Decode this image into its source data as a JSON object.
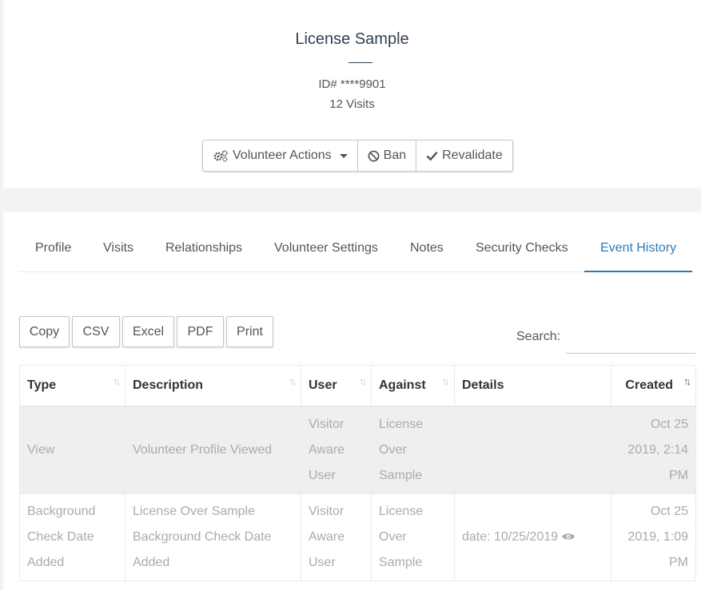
{
  "profile": {
    "name": "License Sample",
    "id_line": "ID# ****9901",
    "visits_line": "12 Visits"
  },
  "actions": {
    "volunteer_actions": "Volunteer Actions",
    "ban": "Ban",
    "revalidate": "Revalidate"
  },
  "tabs": [
    "Profile",
    "Visits",
    "Relationships",
    "Volunteer Settings",
    "Notes",
    "Security Checks",
    "Event History"
  ],
  "active_tab": "Event History",
  "export_buttons": [
    "Copy",
    "CSV",
    "Excel",
    "PDF",
    "Print"
  ],
  "search": {
    "label": "Search:",
    "value": ""
  },
  "table": {
    "columns": [
      "Type",
      "Description",
      "User",
      "Against",
      "Details",
      "Created"
    ],
    "rows": [
      {
        "type": "View",
        "description": "Volunteer Profile Viewed",
        "user": "Visitor Aware User",
        "against": "License Over Sample",
        "details": "",
        "created": "Oct 25 2019, 2:14 PM"
      },
      {
        "type": "Background Check Date Added",
        "description": "License Over Sample Background Check Date Added",
        "user": "Visitor Aware User",
        "against": "License Over Sample",
        "details": "date: 10/25/2019",
        "created": "Oct 25 2019, 1:09 PM"
      }
    ]
  },
  "colors": {
    "accent": "#2b7bb9",
    "muted_text": "#a8abad",
    "row_stripe": "#efefef"
  }
}
